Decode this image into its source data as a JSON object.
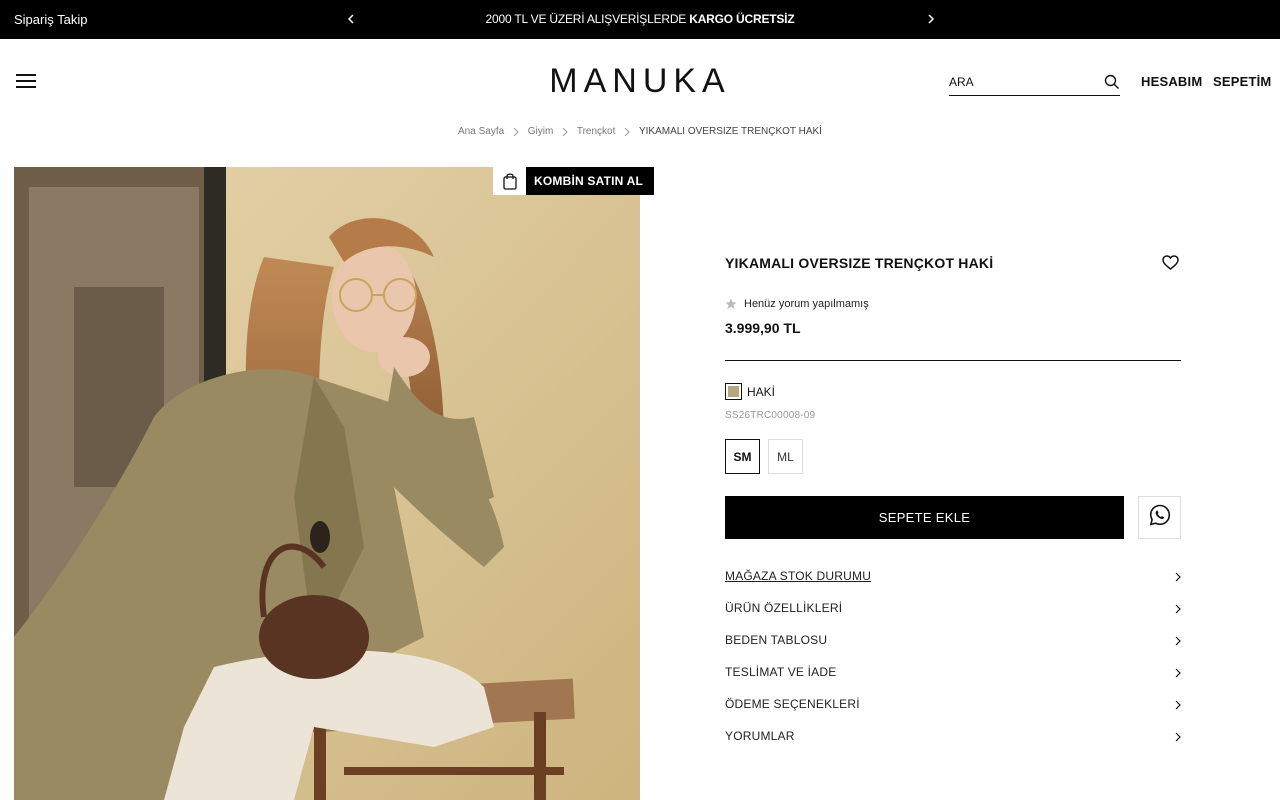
{
  "topbar": {
    "track_label": "Sipariş Takip",
    "message_prefix": "2000 TL VE ÜZERİ ALIŞVERİŞLERDE",
    "message_bold": "KARGO ÜCRETSİZ"
  },
  "header": {
    "logo": "MANUKA",
    "search_placeholder": "ARA",
    "account_label": "HESABIM",
    "cart_label": "SEPETİM"
  },
  "breadcrumb": [
    "Ana Sayfa",
    "Giyim",
    "Trençkot",
    "YIKAMALI OVERSIZE TRENÇKOT HAKİ"
  ],
  "combo": {
    "label": "KOMBİN SATIN AL"
  },
  "product": {
    "title": "YIKAMALI OVERSIZE TRENÇKOT HAKİ",
    "rating_text": "Henüz yorum yapılmamış",
    "price": "3.999,90 TL",
    "color_name": "HAKİ",
    "color_hex": "#b6a87e",
    "sku": "SS26TRC00008-09",
    "sizes": [
      {
        "label": "SM",
        "selected": true
      },
      {
        "label": "ML",
        "selected": false
      }
    ],
    "add_to_cart": "SEPETE EKLE"
  },
  "accordion": [
    "MAĞAZA STOK DURUMU",
    "ÜRÜN ÖZELLİKLERİ",
    "BEDEN TABLOSU",
    "TESLİMAT VE İADE",
    "ÖDEME SEÇENEKLERİ",
    "YORUMLAR"
  ]
}
